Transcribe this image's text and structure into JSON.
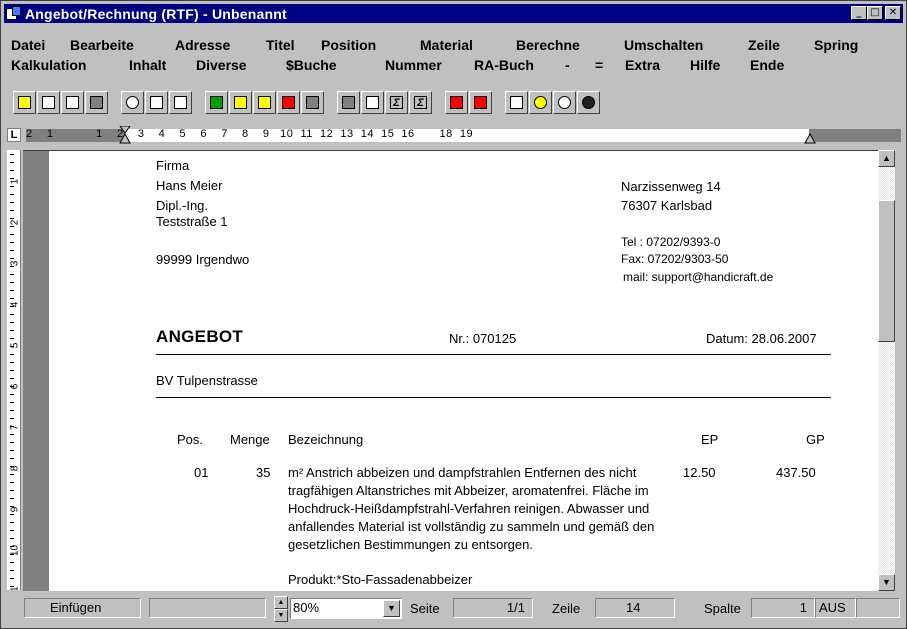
{
  "window": {
    "title": "Angebot/Rechnung (RTF)  - Unbenannt",
    "buttons": {
      "minimize": "_",
      "maximize": "□",
      "close": "✕"
    }
  },
  "menu": {
    "row1": [
      "Datei",
      "Bearbeite",
      "Adresse",
      "Titel",
      "Position",
      "Material",
      "Berechne",
      "Umschalten",
      "Zeile",
      "Spring"
    ],
    "row2": [
      "Kalkulation",
      "Inhalt",
      "Diverse",
      "$Buche",
      "Nummer",
      "RA-Buch",
      "-",
      "=",
      "Extra",
      "Hilfe",
      "Ende"
    ]
  },
  "ruler": {
    "corner": "L",
    "numbers": "2    1            1    2    3    4    5    6    7    8    9   10  11  12  13  14  15  16       18  19"
  },
  "vruler": [
    "1",
    "2",
    "3",
    "4",
    "5",
    "6",
    "7",
    "8",
    "9",
    "10",
    "11"
  ],
  "document": {
    "sender": {
      "line1": "Firma",
      "line2": "Hans Meier",
      "line3": "Dipl.-Ing.",
      "line4": "Teststraße 1",
      "line5": "99999 Irgendwo"
    },
    "company": {
      "street": "Narzissenweg 14",
      "city": "76307 Karlsbad",
      "tel": "Tel : 07202/9393-0",
      "fax": "Fax: 07202/9303-50",
      "mail": "mail:  support@handicraft.de"
    },
    "doc_type": "ANGEBOT",
    "number": "Nr.: 070125",
    "date": "Datum: 28.06.2007",
    "project": "BV Tulpenstrasse",
    "columns": {
      "pos": "Pos.",
      "menge": "Menge",
      "bezeichnung": "Bezeichnung",
      "ep": "EP",
      "gp": "GP"
    },
    "position": {
      "pos": "01",
      "menge": "35",
      "text": "m² Anstrich abbeizen und dampfstrahlen  Entfernen des nicht tragfähigen Altanstriches mit Abbeizer, aromatenfrei. Fläche im Hochdruck-Heißdampfstrahl-Verfahren reinigen. Abwasser und anfallendes Material ist vollständig zu sammeln und gemäß den gesetzlichen Bestimmungen zu entsorgen.",
      "product": "Produkt:*Sto-Fassadenabbeizer",
      "ep": "12.50",
      "gp": "437.50"
    }
  },
  "status": {
    "mode": "Einfügen",
    "zoom": "80%",
    "seite_label": "Seite",
    "seite": "1/1",
    "zeile_label": "Zeile",
    "zeile": "14",
    "spalte_label": "Spalte",
    "spalte": "1",
    "aus": "AUS"
  }
}
